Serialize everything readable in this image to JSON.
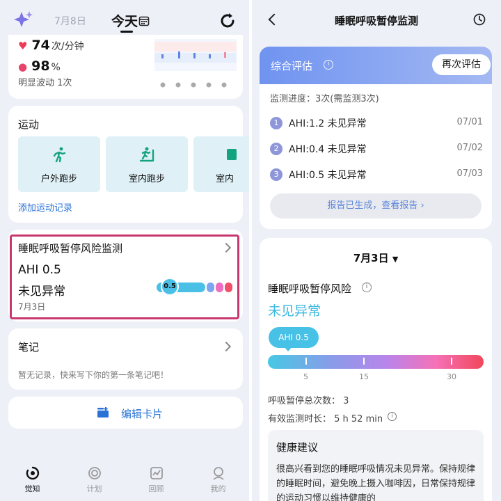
{
  "left": {
    "header": {
      "date": "7月8日",
      "today": "今天"
    },
    "vitals": {
      "heart_rate_value": "74",
      "heart_rate_unit": "次/分钟",
      "spo2_value": "98",
      "spo2_unit": "%",
      "fluctuation": "明显波动 1次"
    },
    "exercise": {
      "title": "运动",
      "items": [
        {
          "label": "户外跑步",
          "icon": "running-icon"
        },
        {
          "label": "室内跑步",
          "icon": "treadmill-icon"
        },
        {
          "label": "室内",
          "icon": "indoor-icon"
        }
      ],
      "add_link": "添加运动记录"
    },
    "sleep_apnea": {
      "title": "睡眠呼吸暂停风险监测",
      "ahi": "AHI 0.5",
      "status": "未见异常",
      "date": "7月3日",
      "bubble": "0.5",
      "dot_colors": [
        "#7ea6f0",
        "#f06ec0",
        "#f0506a"
      ]
    },
    "notes": {
      "title": "笔记",
      "empty": "暂无记录，快来写下你的第一条笔记吧！"
    },
    "edit_card": "编辑卡片",
    "tabs": [
      {
        "label": "觉知",
        "icon": "awareness-icon",
        "active": true
      },
      {
        "label": "计划",
        "icon": "plan-icon",
        "active": false
      },
      {
        "label": "回顾",
        "icon": "review-icon",
        "active": false
      },
      {
        "label": "我的",
        "icon": "profile-icon",
        "active": false
      }
    ]
  },
  "right": {
    "header": {
      "title": "睡眠呼吸暂停监测"
    },
    "evaluation": {
      "title": "综合评估",
      "re_evaluate": "再次评估",
      "progress": "监测进度：3次(需监测3次)",
      "records": [
        {
          "num": "1",
          "text": "AHI:1.2  未见异常",
          "date": "07/01"
        },
        {
          "num": "2",
          "text": "AHI:0.4  未见异常",
          "date": "07/02"
        },
        {
          "num": "3",
          "text": "AHI:0.5  未见异常",
          "date": "07/03"
        }
      ],
      "report_button": "报告已生成，查看报告 ›"
    },
    "detail": {
      "date_selector": "7月3日",
      "risk_title": "睡眠呼吸暂停风险",
      "risk_result": "未见异常",
      "ahi_bubble": "AHI 0.5",
      "scale_ticks": [
        "5",
        "15",
        "30"
      ],
      "apnea_count": "呼吸暂停总次数：  3",
      "duration": "有效监测时长：  5 h 52 min",
      "advice_title": "健康建议",
      "advice_text": "很高兴看到您的睡眠呼吸情况未见异常。保持规律的睡眠时间，避免晚上摄入咖啡因，日常保持规律的运动习惯以维持健康的"
    }
  },
  "colors": {
    "accent_blue": "#2a72d6",
    "highlight_border": "#c8386f",
    "normal_cyan": "#3bb9e2"
  }
}
